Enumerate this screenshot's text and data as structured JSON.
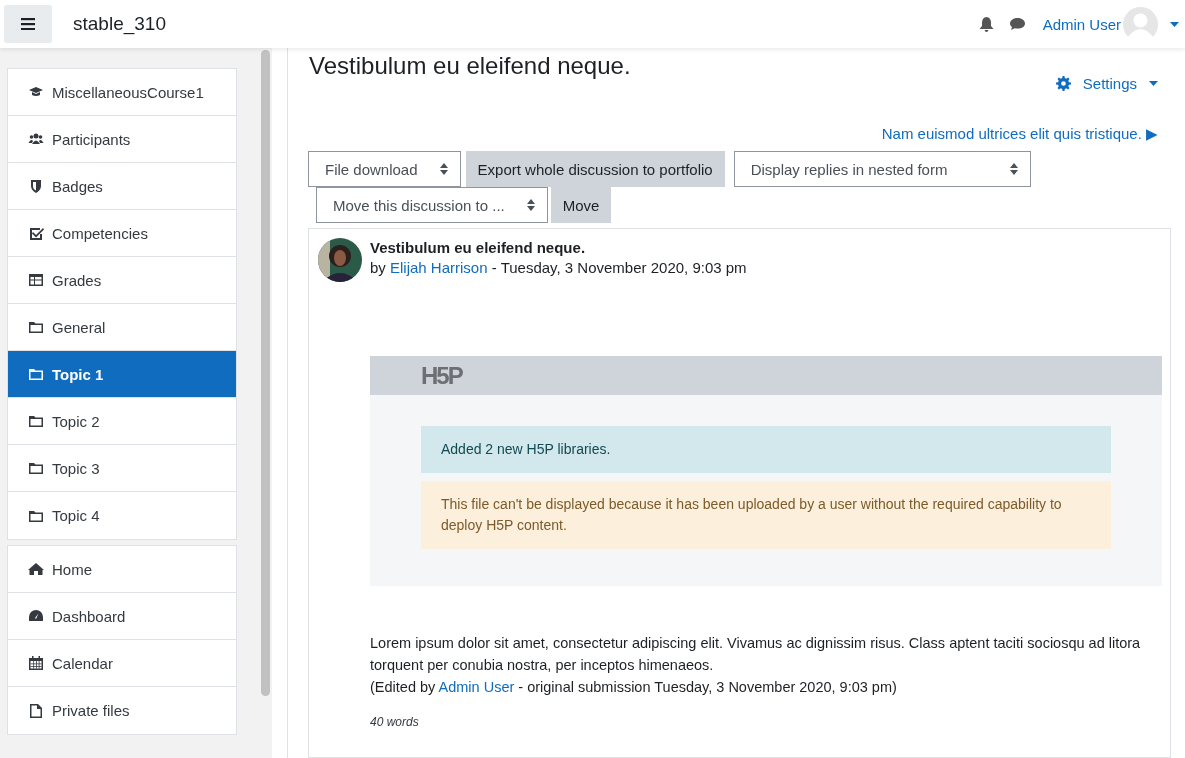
{
  "header": {
    "site_name": "stable_310",
    "user_name": "Admin User"
  },
  "sidebar": {
    "sections": [
      {
        "items": [
          {
            "kind": "course",
            "label": "MiscellaneousCourse1",
            "selected": false
          },
          {
            "kind": "people",
            "label": "Participants",
            "selected": false
          },
          {
            "kind": "shield",
            "label": "Badges",
            "selected": false
          },
          {
            "kind": "check",
            "label": "Competencies",
            "selected": false
          },
          {
            "kind": "table",
            "label": "Grades",
            "selected": false
          },
          {
            "kind": "folder",
            "label": "General",
            "selected": false
          },
          {
            "kind": "folder",
            "label": "Topic 1",
            "selected": true
          },
          {
            "kind": "folder",
            "label": "Topic 2",
            "selected": false
          },
          {
            "kind": "folder",
            "label": "Topic 3",
            "selected": false
          },
          {
            "kind": "folder",
            "label": "Topic 4",
            "selected": false
          }
        ]
      },
      {
        "items": [
          {
            "kind": "home",
            "label": "Home",
            "selected": false
          },
          {
            "kind": "dashboard",
            "label": "Dashboard",
            "selected": false
          },
          {
            "kind": "calendar",
            "label": "Calendar",
            "selected": false
          },
          {
            "kind": "file",
            "label": "Private files",
            "selected": false
          }
        ]
      }
    ]
  },
  "page": {
    "title": "Vestibulum eu eleifend neque.",
    "settings_label": "Settings",
    "next_link": "Nam euismod ultrices elit quis tristique. ▶"
  },
  "control_rows": [
    [
      {
        "kind": "select",
        "label": "File download"
      },
      {
        "kind": "button",
        "label": "Export whole discussion to portfolio"
      },
      {
        "kind": "select",
        "label": "Display replies in nested form"
      }
    ],
    [
      {
        "kind": "select",
        "label": "Move this discussion to ..."
      },
      {
        "kind": "button",
        "label": "Move"
      }
    ]
  ],
  "post": {
    "subject": "Vestibulum eu eleifend neque.",
    "by": "by",
    "author": "Elijah Harrison",
    "date": "- Tuesday, 3 November 2020, 9:03 pm",
    "h5p": {
      "logo": "H5P",
      "alerts": [
        {
          "kind": "info",
          "text": "Added 2 new H5P libraries."
        },
        {
          "kind": "warning",
          "text": "This file can't be displayed because it has been uploaded by a user without the required capability to deploy H5P content."
        }
      ]
    },
    "message": "Lorem ipsum dolor sit amet, consectetur adipiscing elit. Vivamus ac dignissim risus. Class aptent taciti sociosqu ad litora torquent per conubia nostra, per inceptos himenaeos.",
    "edit_prefix": "(Edited by",
    "edit_user": "Admin User",
    "edit_suffix": "- original submission Tuesday, 3 November 2020, 9:03 pm)",
    "word_count": "40 words"
  }
}
